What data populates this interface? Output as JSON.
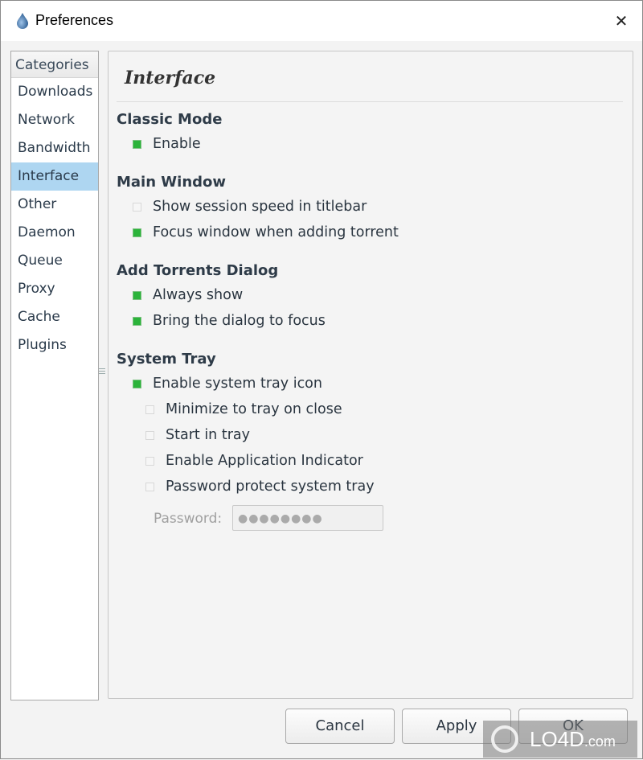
{
  "window": {
    "title": "Preferences",
    "close_glyph": "✕"
  },
  "sidebar": {
    "header": "Categories",
    "items": [
      {
        "label": "Downloads",
        "selected": false
      },
      {
        "label": "Network",
        "selected": false
      },
      {
        "label": "Bandwidth",
        "selected": false
      },
      {
        "label": "Interface",
        "selected": true
      },
      {
        "label": "Other",
        "selected": false
      },
      {
        "label": "Daemon",
        "selected": false
      },
      {
        "label": "Queue",
        "selected": false
      },
      {
        "label": "Proxy",
        "selected": false
      },
      {
        "label": "Cache",
        "selected": false
      },
      {
        "label": "Plugins",
        "selected": false
      }
    ]
  },
  "panel": {
    "title": "Interface",
    "sections": {
      "classic_mode": {
        "heading": "Classic Mode",
        "options": [
          {
            "label": "Enable",
            "checked": true
          }
        ]
      },
      "main_window": {
        "heading": "Main Window",
        "options": [
          {
            "label": "Show session speed in titlebar",
            "checked": false
          },
          {
            "label": "Focus window when adding torrent",
            "checked": true
          }
        ]
      },
      "add_torrents_dialog": {
        "heading": "Add Torrents Dialog",
        "options": [
          {
            "label": "Always show",
            "checked": true
          },
          {
            "label": "Bring the dialog to focus",
            "checked": true
          }
        ]
      },
      "system_tray": {
        "heading": "System Tray",
        "options": [
          {
            "label": "Enable system tray icon",
            "checked": true
          },
          {
            "label": "Minimize to tray on close",
            "checked": false
          },
          {
            "label": "Start in tray",
            "checked": false
          },
          {
            "label": "Enable Application Indicator",
            "checked": false
          },
          {
            "label": "Password protect system tray",
            "checked": false
          }
        ],
        "password_label": "Password:",
        "password_value": "●●●●●●●●"
      }
    }
  },
  "buttons": {
    "cancel": "Cancel",
    "apply": "Apply",
    "ok": "OK"
  },
  "watermark": {
    "text": "LO4D",
    "suffix": ".com"
  }
}
